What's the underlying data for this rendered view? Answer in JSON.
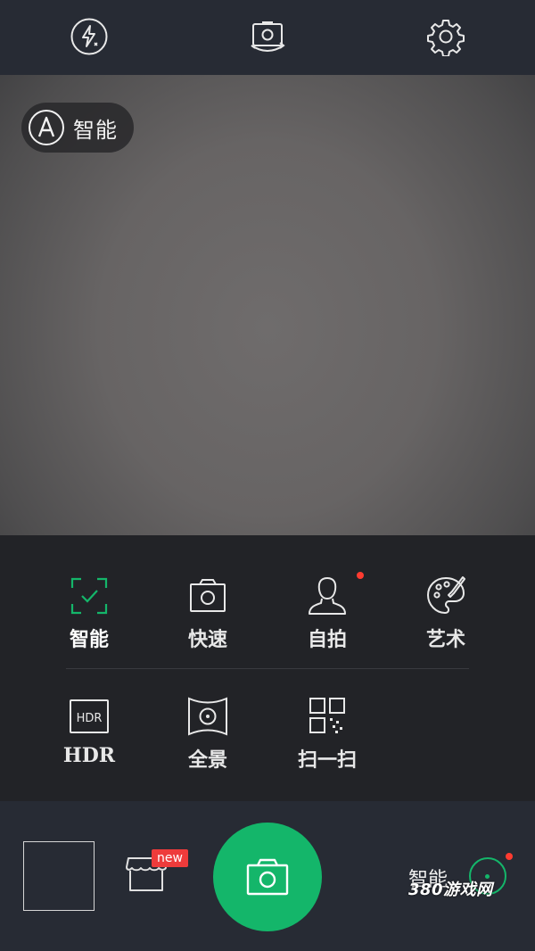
{
  "topbar": {
    "flash_icon": "flash-auto-icon",
    "switch_icon": "camera-switch-icon",
    "settings_icon": "gear-icon"
  },
  "viewfinder": {
    "mode_pill": {
      "icon": "auto-A-icon",
      "label": "智能"
    }
  },
  "modes": {
    "row1": [
      {
        "label": "智能",
        "icon": "smart-check-icon",
        "active": true
      },
      {
        "label": "快速",
        "icon": "camera-icon"
      },
      {
        "label": "自拍",
        "icon": "person-icon",
        "has_dot": true
      },
      {
        "label": "艺术",
        "icon": "palette-icon"
      }
    ],
    "row2": [
      {
        "label": "HDR",
        "icon": "hdr-icon"
      },
      {
        "label": "全景",
        "icon": "panorama-icon"
      },
      {
        "label": "扫一扫",
        "icon": "qr-scan-icon"
      }
    ]
  },
  "bottombar": {
    "new_badge": "new",
    "mode_label": "智能",
    "watermark": "380游戏网"
  },
  "colors": {
    "accent": "#14b66a",
    "notify": "#ff3b30",
    "bar": "#272b34",
    "panel": "#222327"
  }
}
